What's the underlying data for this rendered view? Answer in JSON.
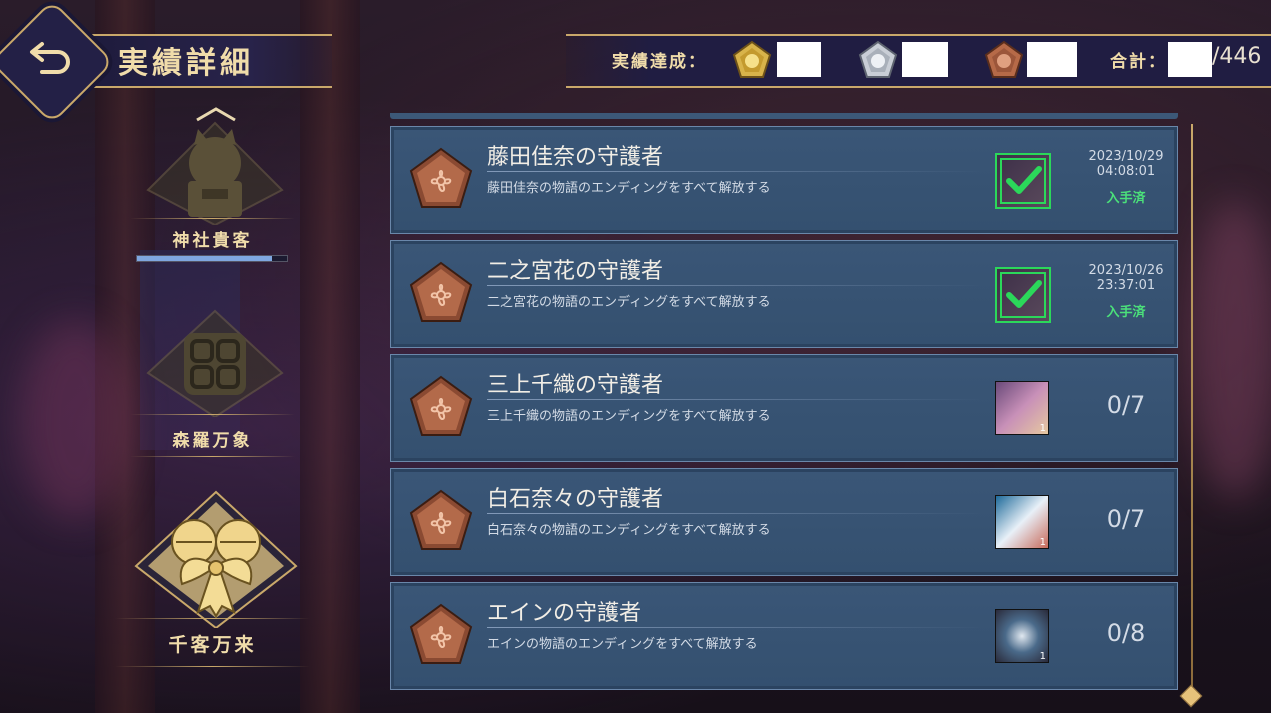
{
  "header": {
    "title": "実績詳細",
    "achievement_label": "実績達成：",
    "total_label": "合計：",
    "total_max": "/446"
  },
  "categories": [
    {
      "label": "神社貴客",
      "icon": "lucky-cat-icon",
      "progress": 0.9
    },
    {
      "label": "森羅万象",
      "icon": "knot-emblem-icon"
    },
    {
      "label": "千客万来",
      "icon": "bells-ribbon-icon",
      "selected": true
    }
  ],
  "achievements": [
    {
      "title": "藤田佳奈の守護者",
      "desc": "藤田佳奈の物語のエンディングをすべて解放する",
      "date": "2023/10/29",
      "time": "04:08:01",
      "status": "入手済",
      "thumb_count": "",
      "completed": true
    },
    {
      "title": "二之宮花の守護者",
      "desc": "二之宮花の物語のエンディングをすべて解放する",
      "date": "2023/10/26",
      "time": "23:37:01",
      "status": "入手済",
      "thumb_count": "",
      "completed": true
    },
    {
      "title": "三上千織の守護者",
      "desc": "三上千織の物語のエンディングをすべて解放する",
      "progress": "0/7",
      "thumb_count": "1",
      "completed": false
    },
    {
      "title": "白石奈々の守護者",
      "desc": "白石奈々の物語のエンディングをすべて解放する",
      "progress": "0/7",
      "thumb_count": "1",
      "completed": false
    },
    {
      "title": "エインの守護者",
      "desc": "エインの物語のエンディングをすべて解放する",
      "progress": "0/8",
      "thumb_count": "1",
      "completed": false
    }
  ],
  "colors": {
    "gold": "#c9a86a",
    "bronze": "#a8603f",
    "green": "#4be07a",
    "card": "#3a5677"
  }
}
